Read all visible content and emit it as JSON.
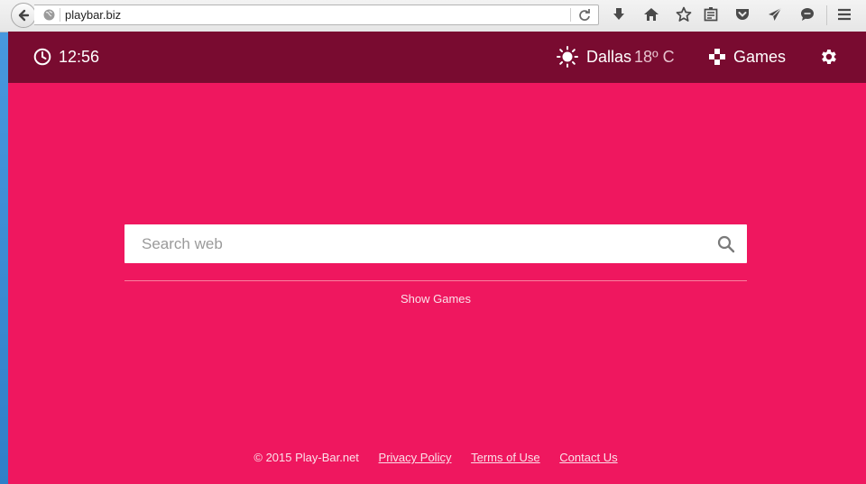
{
  "browser": {
    "url": "playbar.biz",
    "toolbar_icons": [
      "download-icon",
      "home-icon",
      "bookmark-star-icon",
      "reading-list-icon",
      "pocket-icon",
      "send-icon",
      "chat-icon",
      "menu-icon"
    ]
  },
  "topbar": {
    "time": "12:56",
    "city": "Dallas",
    "temperature": "18º C",
    "games_label": "Games"
  },
  "search": {
    "placeholder": "Search web"
  },
  "show_games_label": "Show Games",
  "footer": {
    "copyright": "© 2015 Play-Bar.net",
    "privacy": "Privacy Policy",
    "terms": "Terms of Use",
    "contact": "Contact Us"
  },
  "colors": {
    "page_background": "#ef175f",
    "topbar_background": "#790b30"
  }
}
